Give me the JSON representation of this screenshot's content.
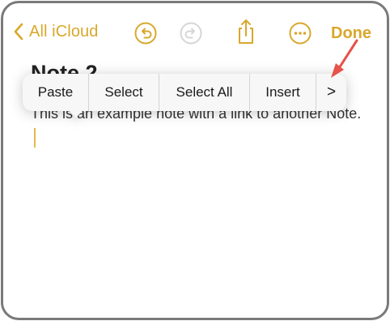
{
  "nav": {
    "back_label": "All iCloud",
    "done_label": "Done",
    "icons": [
      "chevron-left-icon",
      "undo-icon",
      "redo-icon",
      "share-icon",
      "more-icon"
    ]
  },
  "note": {
    "title": "Note 2",
    "body": "This is an example note with a link to another Note."
  },
  "context_menu": {
    "items": [
      "Paste",
      "Select",
      "Select All",
      "Insert"
    ],
    "more_label": ">"
  },
  "colors": {
    "accent": "#d8a82c",
    "annotation_arrow": "#e5534b"
  }
}
